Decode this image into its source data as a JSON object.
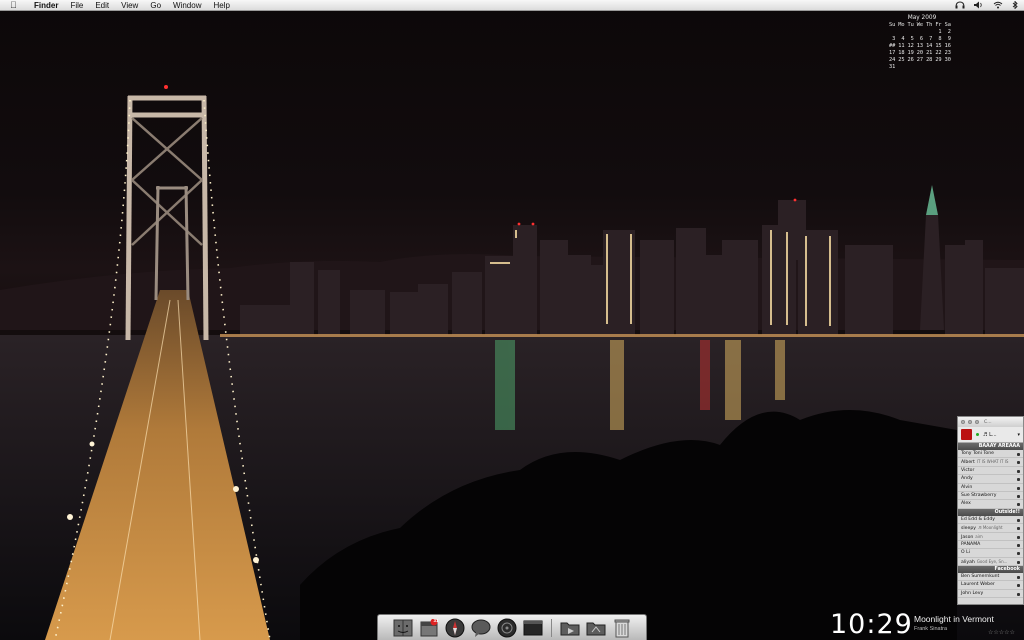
{
  "menubar": {
    "apple_icon": "apple-icon",
    "app_name": "Finder",
    "menus": [
      "File",
      "Edit",
      "View",
      "Go",
      "Window",
      "Help"
    ],
    "status_icons": [
      "headphones-icon",
      "volume-icon",
      "wifi-icon",
      "bluetooth-icon"
    ]
  },
  "calendar": {
    "title": "May 2009",
    "header": "Su Mo Tu We Th Fr Sa",
    "rows": [
      "                1  2",
      " 3  4  5  6  7  8  9",
      "## 11 12 13 14 15 16",
      "17 18 19 20 21 22 23",
      "24 25 26 27 28 29 30",
      "31"
    ]
  },
  "buddylist": {
    "window_title": "C...",
    "status_text": "♬ L...",
    "groups": [
      {
        "name": "BAAAY AREAAA",
        "buddies": [
          {
            "name": "Tony Toni Tone",
            "message": ""
          },
          {
            "name": "Albert",
            "message": "IT IS WHAT IT IS"
          },
          {
            "name": "Victor",
            "message": ""
          },
          {
            "name": "Andy",
            "message": ""
          },
          {
            "name": "Alvin",
            "message": ""
          },
          {
            "name": "Sue Strawberry",
            "message": ""
          },
          {
            "name": "Alex",
            "message": ""
          }
        ]
      },
      {
        "name": "Outside!!",
        "buddies": [
          {
            "name": "Ed Edd & Eddy",
            "message": ""
          },
          {
            "name": "sleepy",
            "message": "♬ Moonlight"
          },
          {
            "name": "Jason",
            "message": "aim"
          },
          {
            "name": "PANAMA",
            "message": ""
          },
          {
            "name": "O Li",
            "message": ""
          },
          {
            "name": "aliyah",
            "message": "Good Eye, Sn..."
          }
        ]
      },
      {
        "name": "Facebook",
        "buddies": [
          {
            "name": "Ben Sumernkunt",
            "message": ""
          },
          {
            "name": "Laurent Weber",
            "message": ""
          },
          {
            "name": "John Levy",
            "message": ""
          }
        ]
      }
    ]
  },
  "dock": {
    "items": [
      "finder-icon",
      "calendar-icon",
      "safari-icon",
      "messages-icon",
      "itunes-icon",
      "terminal-icon",
      "folder-icon",
      "folder-icon",
      "trash-icon"
    ],
    "calendar_badge": "31"
  },
  "itunes": {
    "time": "10:29",
    "song": "Moonlight in Vermont",
    "artist": "Frank Sinatra",
    "rating": "☆☆☆☆☆"
  }
}
